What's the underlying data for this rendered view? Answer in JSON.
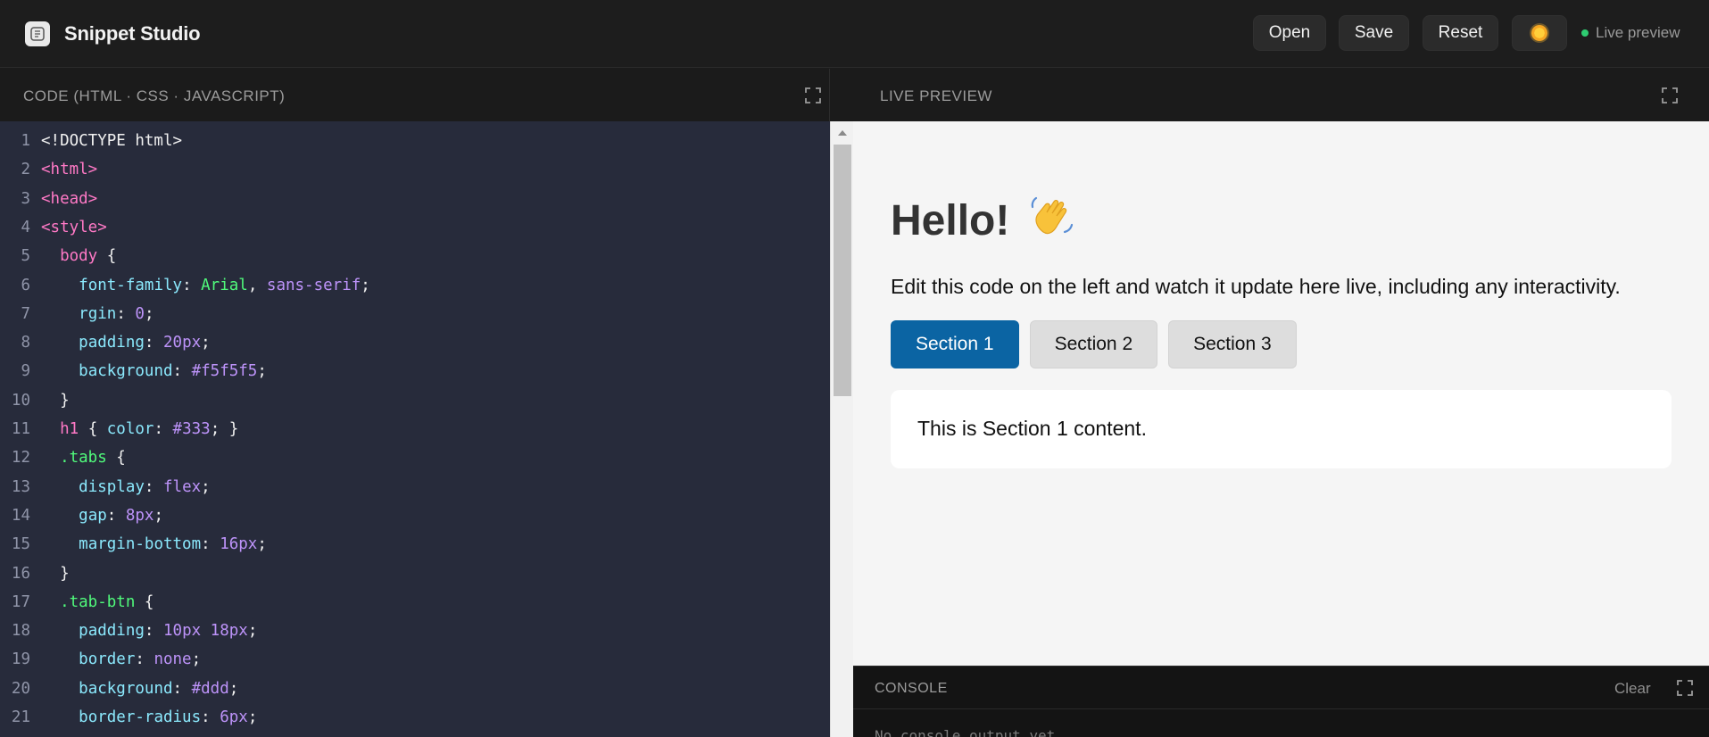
{
  "app": {
    "title": "Snippet Studio",
    "logo_icon": "brain-icon"
  },
  "toolbar": {
    "open_label": "Open",
    "save_label": "Save",
    "reset_label": "Reset",
    "theme_icon": "sun-icon",
    "status_label": "Live preview",
    "status_color": "#2ecc71"
  },
  "code_panel": {
    "header": "CODE (HTML · CSS · JAVASCRIPT)",
    "expand_icon": "expand-icon",
    "lines": [
      {
        "n": "1",
        "tokens": [
          [
            "plain",
            "<!DOCTYPE html>"
          ]
        ]
      },
      {
        "n": "2",
        "tokens": [
          [
            "tag",
            "<html>"
          ]
        ]
      },
      {
        "n": "3",
        "tokens": [
          [
            "tag",
            "<head>"
          ]
        ]
      },
      {
        "n": "4",
        "tokens": [
          [
            "tag",
            "<style>"
          ]
        ]
      },
      {
        "n": "5",
        "tokens": [
          [
            "plain",
            "  "
          ],
          [
            "tag",
            "body"
          ],
          [
            "plain",
            " {"
          ]
        ]
      },
      {
        "n": "6",
        "tokens": [
          [
            "plain",
            "    "
          ],
          [
            "prop",
            "font-family"
          ],
          [
            "plain",
            ": "
          ],
          [
            "str",
            "Arial"
          ],
          [
            "plain",
            ", "
          ],
          [
            "kw",
            "sans-serif"
          ],
          [
            "plain",
            ";"
          ]
        ]
      },
      {
        "n": "7",
        "tokens": [
          [
            "plain",
            "    "
          ],
          [
            "prop",
            "rgin"
          ],
          [
            "plain",
            ": "
          ],
          [
            "num",
            "0"
          ],
          [
            "plain",
            ";"
          ]
        ]
      },
      {
        "n": "8",
        "tokens": [
          [
            "plain",
            "    "
          ],
          [
            "prop",
            "padding"
          ],
          [
            "plain",
            ": "
          ],
          [
            "num",
            "20px"
          ],
          [
            "plain",
            ";"
          ]
        ]
      },
      {
        "n": "9",
        "tokens": [
          [
            "plain",
            "    "
          ],
          [
            "prop",
            "background"
          ],
          [
            "plain",
            ": "
          ],
          [
            "num",
            "#f5f5f5"
          ],
          [
            "plain",
            ";"
          ]
        ]
      },
      {
        "n": "10",
        "tokens": [
          [
            "plain",
            "  }"
          ]
        ]
      },
      {
        "n": "11",
        "tokens": [
          [
            "plain",
            "  "
          ],
          [
            "tag",
            "h1"
          ],
          [
            "plain",
            " { "
          ],
          [
            "prop",
            "color"
          ],
          [
            "plain",
            ": "
          ],
          [
            "num",
            "#333"
          ],
          [
            "plain",
            "; }"
          ]
        ]
      },
      {
        "n": "12",
        "tokens": [
          [
            "plain",
            "  "
          ],
          [
            "sel",
            ".tabs"
          ],
          [
            "plain",
            " {"
          ]
        ]
      },
      {
        "n": "13",
        "tokens": [
          [
            "plain",
            "    "
          ],
          [
            "prop",
            "display"
          ],
          [
            "plain",
            ": "
          ],
          [
            "kw",
            "flex"
          ],
          [
            "plain",
            ";"
          ]
        ]
      },
      {
        "n": "14",
        "tokens": [
          [
            "plain",
            "    "
          ],
          [
            "prop",
            "gap"
          ],
          [
            "plain",
            ": "
          ],
          [
            "num",
            "8px"
          ],
          [
            "plain",
            ";"
          ]
        ]
      },
      {
        "n": "15",
        "tokens": [
          [
            "plain",
            "    "
          ],
          [
            "prop",
            "margin-bottom"
          ],
          [
            "plain",
            ": "
          ],
          [
            "num",
            "16px"
          ],
          [
            "plain",
            ";"
          ]
        ]
      },
      {
        "n": "16",
        "tokens": [
          [
            "plain",
            "  }"
          ]
        ]
      },
      {
        "n": "17",
        "tokens": [
          [
            "plain",
            "  "
          ],
          [
            "sel",
            ".tab-btn"
          ],
          [
            "plain",
            " {"
          ]
        ]
      },
      {
        "n": "18",
        "tokens": [
          [
            "plain",
            "    "
          ],
          [
            "prop",
            "padding"
          ],
          [
            "plain",
            ": "
          ],
          [
            "num",
            "10px 18px"
          ],
          [
            "plain",
            ";"
          ]
        ]
      },
      {
        "n": "19",
        "tokens": [
          [
            "plain",
            "    "
          ],
          [
            "prop",
            "border"
          ],
          [
            "plain",
            ": "
          ],
          [
            "kw",
            "none"
          ],
          [
            "plain",
            ";"
          ]
        ]
      },
      {
        "n": "20",
        "tokens": [
          [
            "plain",
            "    "
          ],
          [
            "prop",
            "background"
          ],
          [
            "plain",
            ": "
          ],
          [
            "num",
            "#ddd"
          ],
          [
            "plain",
            ";"
          ]
        ]
      },
      {
        "n": "21",
        "tokens": [
          [
            "plain",
            "    "
          ],
          [
            "prop",
            "border-radius"
          ],
          [
            "plain",
            ": "
          ],
          [
            "num",
            "6px"
          ],
          [
            "plain",
            ";"
          ]
        ]
      }
    ]
  },
  "preview_panel": {
    "header": "LIVE PREVIEW",
    "expand_icon": "expand-icon",
    "heading": "Hello!",
    "heading_emoji": "waving-hand-icon",
    "description": "Edit this code on the left and watch it update here live, including any interactivity.",
    "tabs": [
      {
        "label": "Section 1",
        "active": true
      },
      {
        "label": "Section 2",
        "active": false
      },
      {
        "label": "Section 3",
        "active": false
      }
    ],
    "tab_content": "This is Section 1 content.",
    "active_tab_color": "#0b64a3"
  },
  "console": {
    "header": "CONSOLE",
    "clear_label": "Clear",
    "expand_icon": "expand-icon",
    "output": "No console output yet."
  }
}
